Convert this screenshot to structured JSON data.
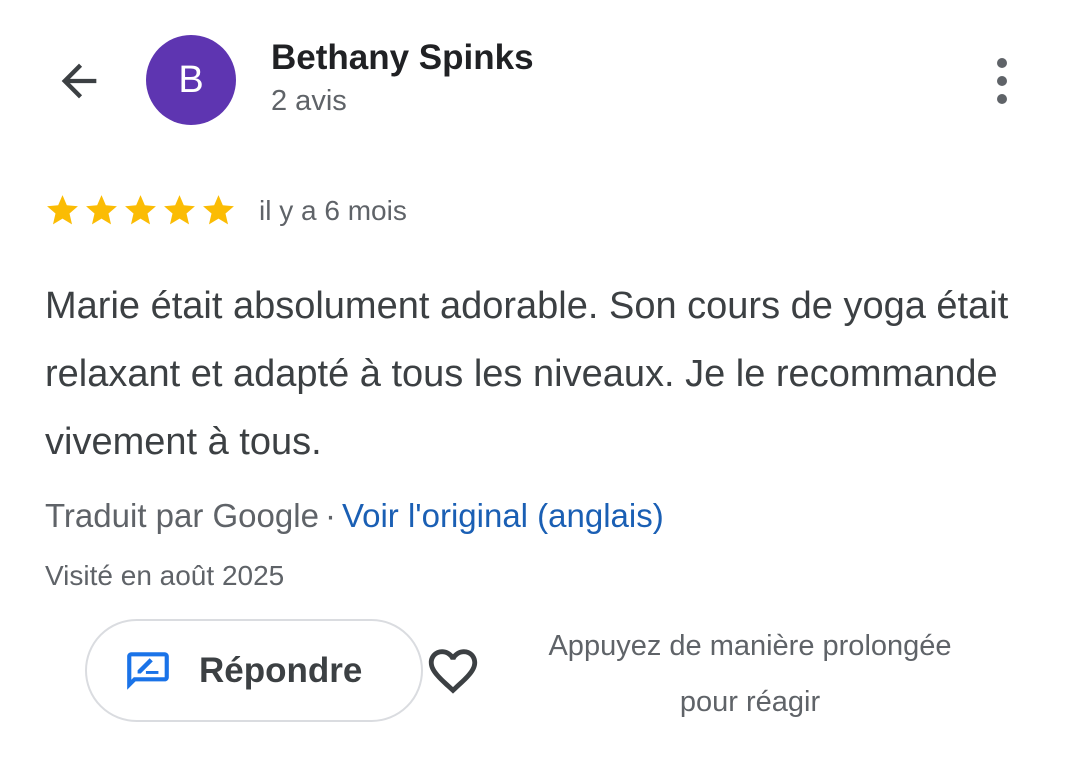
{
  "header": {
    "avatar_initial": "B",
    "avatar_color": "#5e35b1",
    "reviewer_name": "Bethany Spinks",
    "review_count": "2 avis",
    "back_icon": "arrow-back-icon",
    "more_icon": "more-vert-icon"
  },
  "review": {
    "rating": 5,
    "rating_max": 5,
    "star_color": "#fbbc04",
    "date": "il y a 6 mois",
    "text": "Marie était absolument adorable. Son cours de yoga était relaxant et adapté à tous les niveaux. Je le recommande vivement à tous.",
    "translated_by": "Traduit par Google",
    "separator": "·",
    "view_original": "Voir l'original (anglais)",
    "visited": "Visité en août 2025"
  },
  "actions": {
    "reply_label": "Répondre",
    "reply_icon": "reply-edit-icon",
    "heart_icon": "heart-outline-icon",
    "react_hint_line1": "Appuyez de manière prolongée",
    "react_hint_line2": "pour réagir"
  },
  "colors": {
    "link": "#1a5fb4",
    "accent_icon": "#1a73e8"
  }
}
